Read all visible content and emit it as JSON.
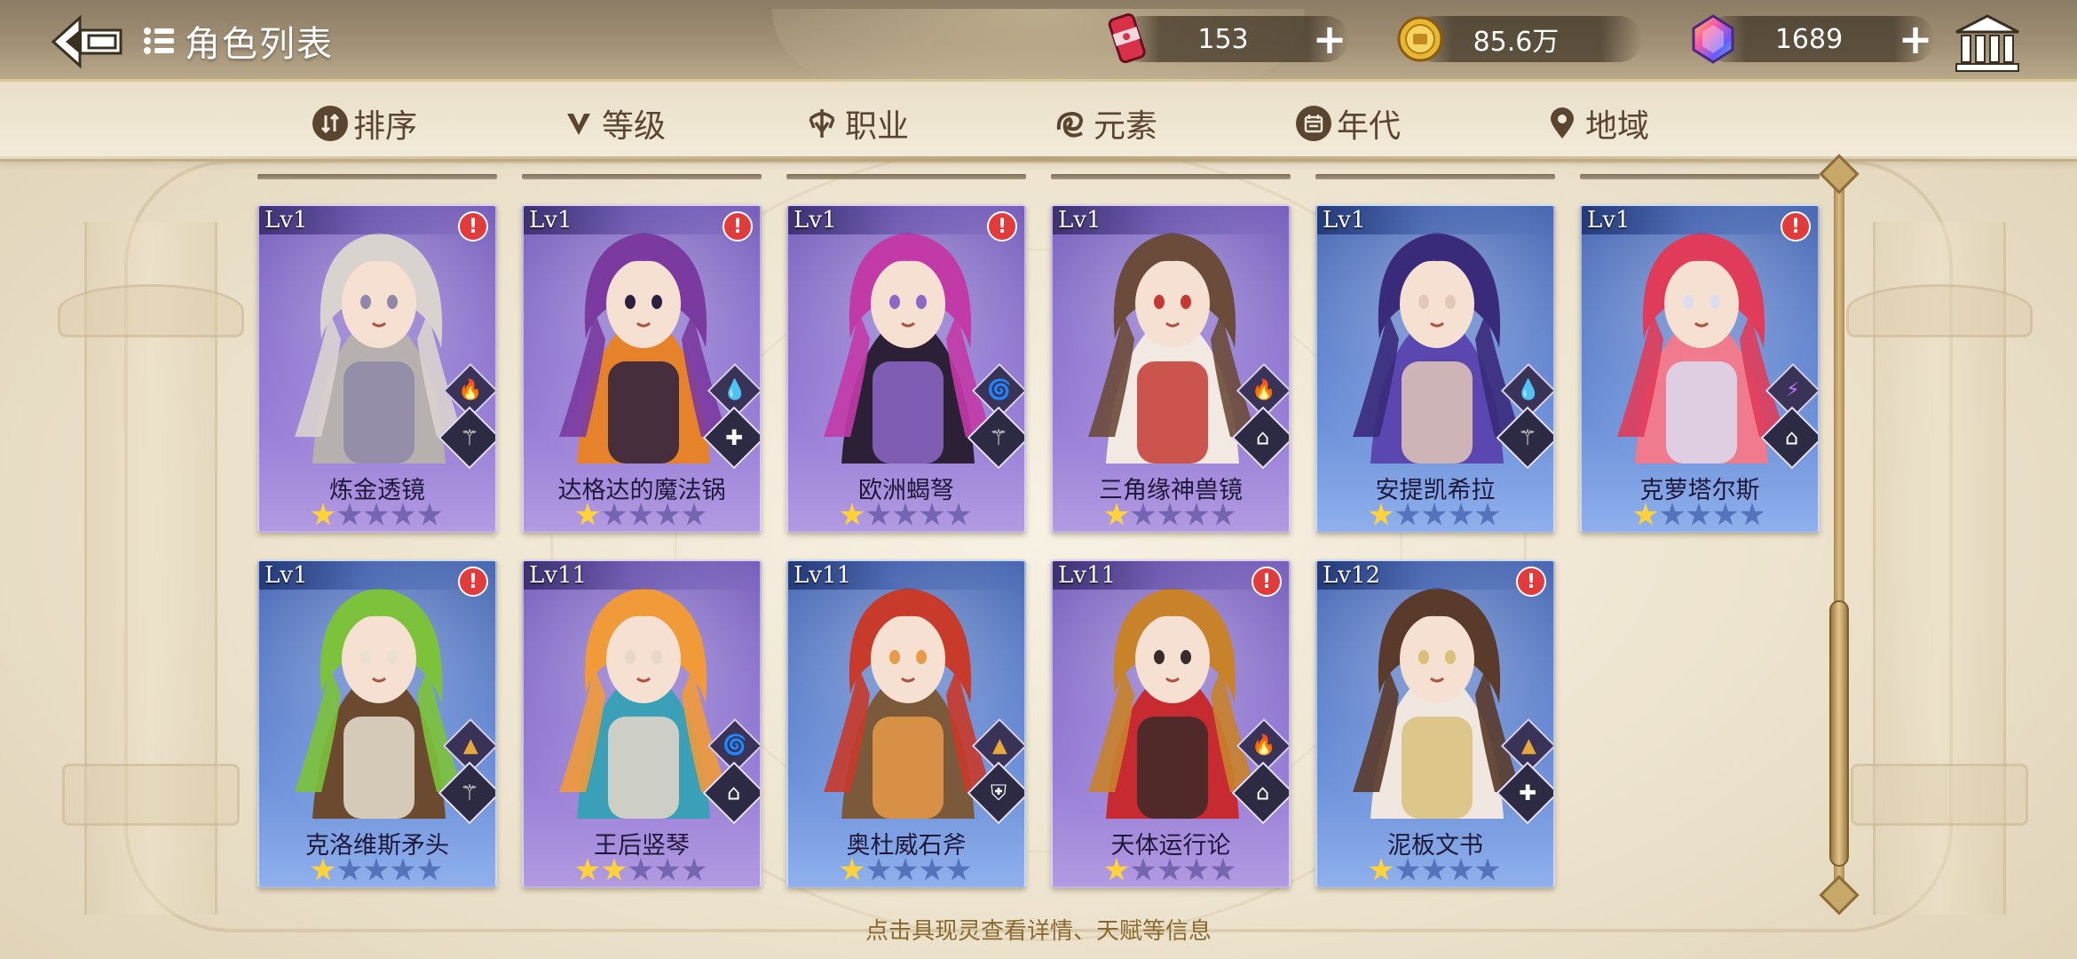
{
  "header": {
    "title": "角色列表",
    "resources": [
      {
        "name": "stamina",
        "icon": "can-icon",
        "value": "153",
        "color": "#d8324a"
      },
      {
        "name": "gold",
        "icon": "gold-coin-icon",
        "value": "85.6万",
        "color": "#e8b830"
      },
      {
        "name": "gem",
        "icon": "rainbow-gem-icon",
        "value": "1689",
        "color": "#9a5ae0"
      }
    ],
    "plus": "+"
  },
  "filters": [
    {
      "label": "排序",
      "icon": "sort-icon"
    },
    {
      "label": "等级",
      "icon": "level-v-icon"
    },
    {
      "label": "职业",
      "icon": "class-icon"
    },
    {
      "label": "元素",
      "icon": "element-icon"
    },
    {
      "label": "年代",
      "icon": "era-icon"
    },
    {
      "label": "地域",
      "icon": "location-pin-icon"
    }
  ],
  "characters": [
    {
      "level": "Lv1",
      "name": "炼金透镜",
      "stars": 1,
      "rarity": "purple",
      "element": "fire",
      "job": "archer",
      "alert": true,
      "palette": [
        "#d9d3cf",
        "#b6b0ae",
        "#8f88a8"
      ]
    },
    {
      "level": "Lv1",
      "name": "达格达的魔法锅",
      "stars": 1,
      "rarity": "purple",
      "element": "water",
      "job": "cross",
      "alert": true,
      "palette": [
        "#7a3aa0",
        "#e5822a",
        "#2b2040"
      ]
    },
    {
      "level": "Lv1",
      "name": "欧洲蝎弩",
      "stars": 1,
      "rarity": "purple",
      "element": "wind",
      "job": "archer",
      "alert": true,
      "palette": [
        "#c23aa8",
        "#2b2035",
        "#8e68c8"
      ]
    },
    {
      "level": "Lv1",
      "name": "三角缘神兽镜",
      "stars": 1,
      "rarity": "purple",
      "element": "fire",
      "job": "book",
      "alert": false,
      "palette": [
        "#6b4b3a",
        "#f2e9e2",
        "#c43a32"
      ]
    },
    {
      "level": "Lv1",
      "name": "安提凯希拉",
      "stars": 1,
      "rarity": "blue",
      "element": "water",
      "job": "archer",
      "alert": false,
      "palette": [
        "#3a2a7a",
        "#5a48b0",
        "#e3c8b8"
      ]
    },
    {
      "level": "Lv1",
      "name": "克萝塔尔斯",
      "stars": 1,
      "rarity": "blue",
      "element": "thunder",
      "job": "book",
      "alert": true,
      "palette": [
        "#e03c5a",
        "#f07a8e",
        "#dcdcf0"
      ]
    },
    {
      "level": "Lv1",
      "name": "克洛维斯矛头",
      "stars": 1,
      "rarity": "blue",
      "element": "earth",
      "job": "archer",
      "alert": true,
      "palette": [
        "#7cc23a",
        "#6b4a30",
        "#e8e0d0"
      ]
    },
    {
      "level": "Lv11",
      "name": "王后竖琴",
      "stars": 2,
      "rarity": "purple",
      "element": "wind",
      "job": "book",
      "alert": false,
      "palette": [
        "#f09a3a",
        "#3aa0b8",
        "#e8d6c8"
      ]
    },
    {
      "level": "Lv11",
      "name": "奥杜威石斧",
      "stars": 1,
      "rarity": "blue",
      "element": "earth",
      "job": "shield",
      "alert": false,
      "palette": [
        "#c83a2a",
        "#7a5a3a",
        "#e89a48"
      ]
    },
    {
      "level": "Lv11",
      "name": "天体运行论",
      "stars": 1,
      "rarity": "purple",
      "element": "fire",
      "job": "book",
      "alert": true,
      "palette": [
        "#c8822a",
        "#c82a32",
        "#3a2a28"
      ]
    },
    {
      "level": "Lv12",
      "name": "泥板文书",
      "stars": 1,
      "rarity": "blue",
      "element": "earth",
      "job": "cross",
      "alert": true,
      "palette": [
        "#5a3a2a",
        "#f0e8e0",
        "#d8c07a"
      ]
    }
  ],
  "hint": "点击具现灵查看详情、天赋等信息"
}
